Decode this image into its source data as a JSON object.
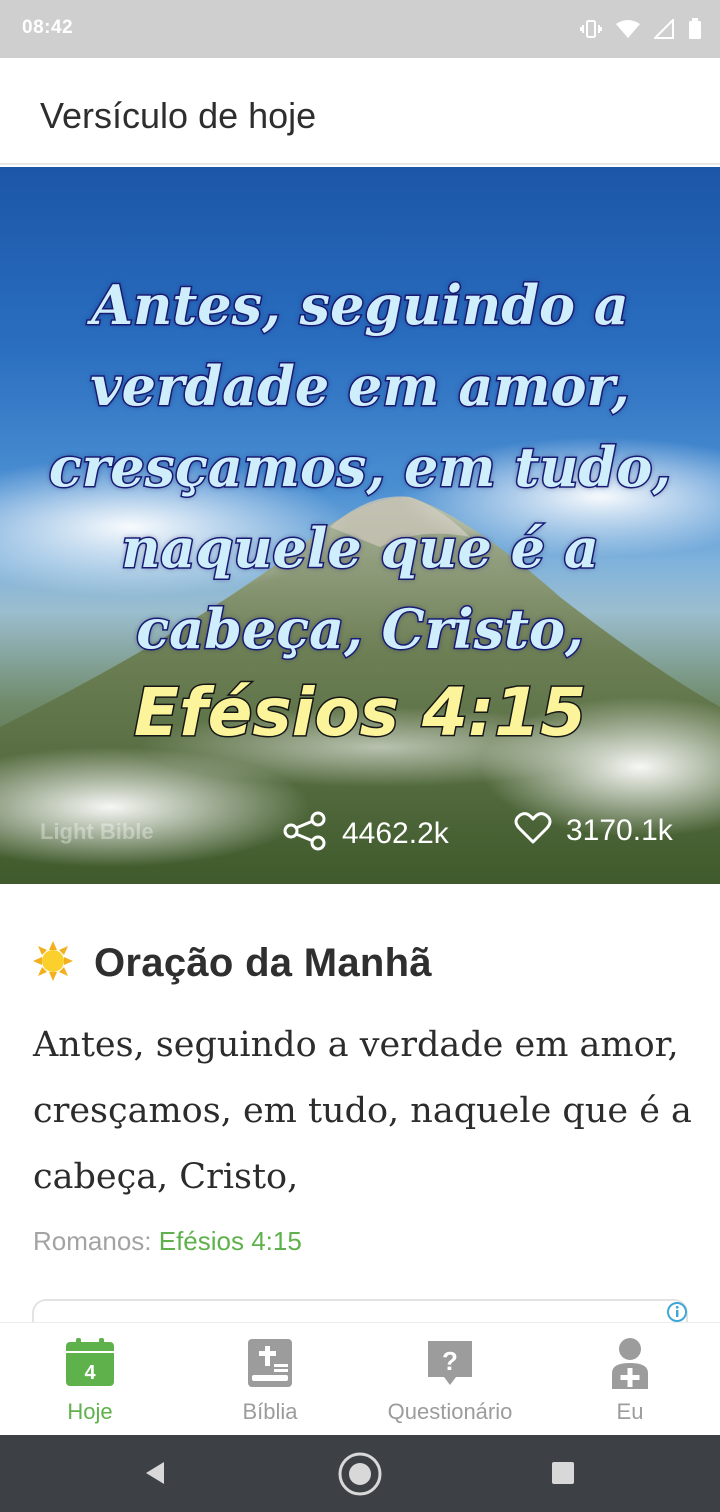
{
  "status_bar": {
    "time": "08:42"
  },
  "header": {
    "title": "Versículo de hoje"
  },
  "verse_card": {
    "verse_lines": [
      "Antes, seguindo a",
      "verdade em amor,",
      "cresçamos, em tudo,",
      "naquele que é a",
      "cabeça, Cristo,"
    ],
    "reference": "Efésios 4:15",
    "watermark": "Light Bible",
    "share_count": "4462.2k",
    "like_count": "3170.1k"
  },
  "prayer": {
    "title": "Oração da Manhã",
    "body": "Antes, seguindo a verdade em amor, cresçamos, em tudo, naquele que é a cabeça, Cristo,",
    "ref_prefix": "Romanos: ",
    "ref_link": "Efésios 4:15"
  },
  "bottom_nav": {
    "items": [
      {
        "label": "Hoje",
        "icon": "calendar-icon",
        "badge": "4",
        "active": true
      },
      {
        "label": "Bíblia",
        "icon": "bible-icon",
        "active": false
      },
      {
        "label": "Questionário",
        "icon": "quiz-icon",
        "active": false
      },
      {
        "label": "Eu",
        "icon": "profile-icon",
        "active": false
      }
    ]
  },
  "colors": {
    "accent": "#5fb24b",
    "inactive": "#9c9c9c",
    "status_bar": "#cfcfcf",
    "android_nav": "#3d4146"
  }
}
